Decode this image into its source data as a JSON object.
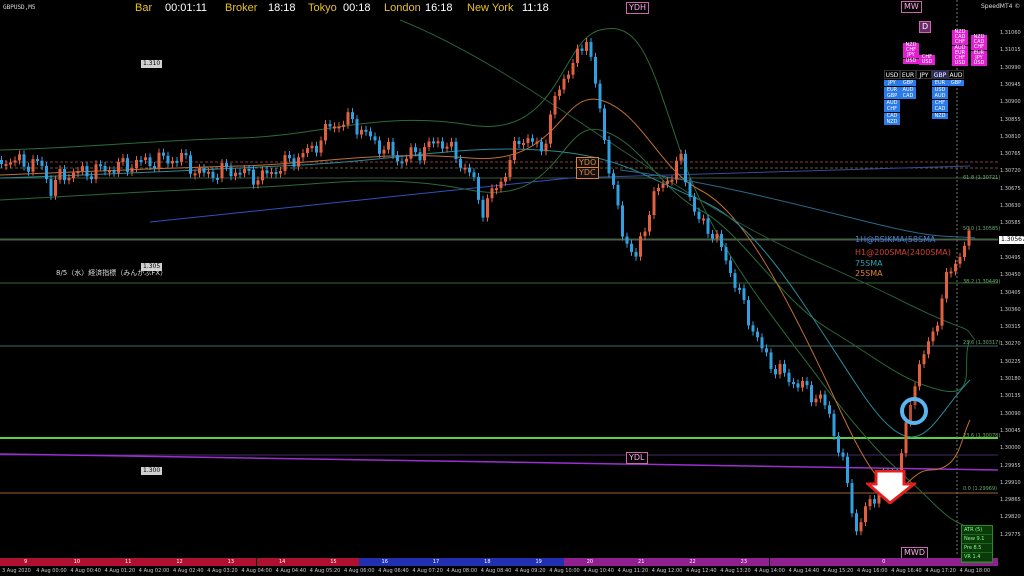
{
  "header": {
    "symbol": "GBPUSD,M5",
    "bar_label": "Bar",
    "bar_value": "00:01:11",
    "broker_label": "Broker",
    "broker_value": "18:18",
    "tokyo_label": "Tokyo",
    "tokyo_value": "00:18",
    "london_label": "London",
    "london_value": "16:18",
    "ny_label": "New York",
    "ny_value": "11:18",
    "speedmt": "SpeedMT4 ©"
  },
  "tags": {
    "ydh": "YDH",
    "mw": "MW",
    "d": "D",
    "ydo": "YDO",
    "ydc": "YDC",
    "ydl": "YDL",
    "mwd": "MWD"
  },
  "price_boxes": {
    "p1": "1.310",
    "p2": "1.305",
    "p3": "1.300"
  },
  "econ_note": "8/5（水）経済指標（みんかぶFX）",
  "legend": {
    "l1": "1H@RSIKMA(58SMA",
    "l2": "H1@200SMA(2400SMA)",
    "l3": "75SMA",
    "l4": "25SMA",
    "l1_color": "#4a7de0",
    "l2_color": "#d04030",
    "l3_color": "#30a0b0",
    "l4_color": "#e08030"
  },
  "currency_strength": {
    "headers": [
      "USD",
      "EUR",
      "JPY",
      "GBP",
      "AUD"
    ],
    "columns": [
      {
        "cells": [
          "JPY",
          "EUR",
          "GBP",
          "AUD",
          "CHF",
          "CAD",
          "NZD"
        ],
        "color": "#2a7ae8"
      },
      {
        "cells": [
          "GBP",
          "AUD",
          "CAD"
        ],
        "color": "#2a7ae8"
      },
      {
        "cells": [],
        "color": "#2a7ae8"
      },
      {
        "cells": [
          "EUR",
          "USD",
          "AUD",
          "CHF",
          "CAD",
          "NZD"
        ],
        "color": "#2a7ae8"
      },
      {
        "cells": [
          "GBP"
        ],
        "color": "#2a7ae8"
      }
    ],
    "top_columns": [
      {
        "cells": [
          "NZD",
          "CHF",
          "JPY",
          "USD"
        ],
        "color": "#e020d0"
      },
      {
        "cells": [
          "CHF",
          "USD"
        ],
        "color": "#e020d0"
      },
      {
        "cells": [
          "NZD",
          "CAD",
          "CHF",
          "AUD",
          "EUR",
          "CHF",
          "USD"
        ],
        "color": "#e020d0"
      },
      {
        "cells": [
          "NZD",
          "CAD",
          "CHF",
          "EUR",
          "JPY",
          "USD"
        ],
        "color": "#e020d0"
      }
    ]
  },
  "stats": {
    "atr": "ATR (5)",
    "new": "New  9.1",
    "pre": "Pre  8.5",
    "vr": "VR  1.4"
  },
  "y_axis": [
    "1.31060",
    "1.31015",
    "1.30990",
    "1.30945",
    "1.30900",
    "1.30855",
    "1.30810",
    "1.30765",
    "1.30720",
    "1.30675",
    "1.30630",
    "1.30585",
    "1.30540",
    "1.30495",
    "1.30450",
    "1.30405",
    "1.30360",
    "1.30315",
    "1.30270",
    "1.30225",
    "1.30180",
    "1.30135",
    "1.30090",
    "1.30045",
    "1.30000",
    "1.29955",
    "1.29910",
    "1.29865",
    "1.29820",
    "1.29775"
  ],
  "current_price": "1.30567",
  "x_axis": [
    "3 Aug 2020",
    "4 Aug 00:00",
    "4 Aug 00:40",
    "4 Aug 01:20",
    "4 Aug 02:00",
    "4 Aug 02:40",
    "4 Aug 03:20",
    "4 Aug 04:00",
    "4 Aug 04:40",
    "4 Aug 05:20",
    "4 Aug 06:00",
    "4 Aug 06:40",
    "4 Aug 07:20",
    "4 Aug 08:00",
    "4 Aug 08:40",
    "4 Aug 09:20",
    "4 Aug 10:00",
    "4 Aug 10:40",
    "4 Aug 11:20",
    "4 Aug 12:00",
    "4 Aug 12:40",
    "4 Aug 13:20",
    "4 Aug 14:00",
    "4 Aug 14:40",
    "4 Aug 15:20",
    "4 Aug 16:00",
    "4 Aug 16:40",
    "4 Aug 17:20",
    "4 Aug 18:00"
  ],
  "day_bar": [
    "9",
    "10",
    "11",
    "12",
    "13",
    "14",
    "15",
    "16",
    "17",
    "18",
    "19",
    "20",
    "21",
    "22",
    "23",
    "0"
  ],
  "fibo_labels": [
    "61.8 (1.30721)",
    "50.0 (1.30585)",
    "38.2 (1.30449)",
    "23.6 (1.30317)",
    "23.6 (1.30078)",
    "0.0 (1.29969)"
  ]
}
